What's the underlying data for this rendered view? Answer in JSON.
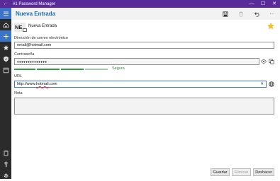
{
  "window": {
    "title": "#1 Password Manager",
    "back_glyph": "←",
    "minimize_glyph": "—",
    "maximize_glyph": "☐",
    "close_glyph": "✕"
  },
  "rail": {
    "items": [
      {
        "name": "menu-icon",
        "active": false
      },
      {
        "name": "home-icon",
        "active": false
      },
      {
        "name": "add-icon",
        "active": true
      },
      {
        "name": "star-icon",
        "active": false
      },
      {
        "name": "shield-icon",
        "active": false
      },
      {
        "name": "card-icon",
        "active": false
      },
      {
        "name": "clipboard-icon",
        "active": false
      },
      {
        "name": "key-icon",
        "active": false
      },
      {
        "name": "gear-icon",
        "active": false
      }
    ]
  },
  "header": {
    "title": "Nueva Entrada",
    "actions": [
      "save-icon",
      "delete-icon",
      "undo-icon",
      "more-icon"
    ],
    "more_glyph": "···"
  },
  "entry": {
    "avatar_initials": "NE",
    "name": "Nueva Entrada",
    "favorite_color": "#f5c518"
  },
  "email": {
    "label": "Dirección de correo electrónico",
    "value": "email@hotmail.com"
  },
  "password": {
    "label": "Contraseña",
    "value": "●●●●●●●●●●●●●●",
    "strength_label": "Segura",
    "strength_color": "#2f9b3f"
  },
  "url": {
    "label": "URL",
    "value_prefix": "http://www.",
    "value_highlight": "hotmail",
    "value_suffix": ".com",
    "clear_glyph": "✕"
  },
  "note": {
    "label": "Nota",
    "value": ""
  },
  "footer": {
    "save_label": "Guardar",
    "delete_label": "Eliminar",
    "discard_label": "Deshacer"
  },
  "colors": {
    "titlebar": "#5a2a99",
    "accent": "#3b73c8",
    "header_title": "#1f6fb2"
  }
}
